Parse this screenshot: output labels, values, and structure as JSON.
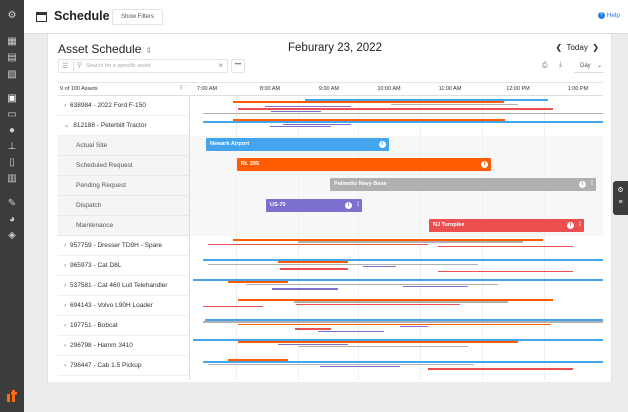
{
  "sidebar": {
    "icons": [
      "settings-icon",
      "grid-icon",
      "chat-icon",
      "document-icon",
      "schedule-icon",
      "monitor-icon",
      "location-icon",
      "org-icon",
      "map-icon",
      "report-icon",
      "wrench-icon",
      "pie-icon",
      "shield-icon"
    ]
  },
  "topbar": {
    "title": "Schedule",
    "show_filters": "Show Filters",
    "help": "Help"
  },
  "card": {
    "title": "Asset Schedule",
    "date": "Feburary 23, 2022",
    "today": "Today",
    "search_placeholder": "Search for a specific asset",
    "view_select": "Day"
  },
  "grid_header": {
    "asset_count": "9 of 100 Assets",
    "times": [
      "7:00 AM",
      "8:00 AM",
      "9:00 AM",
      "10:00 AM",
      "11:00 AM",
      "12:00 PM",
      "1:00 PM"
    ]
  },
  "assets": [
    {
      "label": "638984 - 2022 Ford F-150",
      "expanded": false
    },
    {
      "label": "812188 - Peterbilt Tractor",
      "expanded": true,
      "sub_rows": [
        {
          "label": "Actual Site",
          "event": "Newark Airport",
          "color": "#44a4ee"
        },
        {
          "label": "Scheduled Request",
          "event": "Rt. 295",
          "color": "#ff5b00"
        },
        {
          "label": "Pending Request",
          "event": "Palmetto Navy Base",
          "color": "#b0b0b0"
        },
        {
          "label": "Dispatch",
          "event": "US-70",
          "color": "#7b6fd0"
        },
        {
          "label": "Maintenance",
          "event": "NJ Turnpike",
          "color": "#ec4f4f"
        }
      ]
    },
    {
      "label": "957759 - Dresser TD9H - Spare",
      "expanded": false
    },
    {
      "label": "965973 - Cat D8L",
      "expanded": false
    },
    {
      "label": "537581 - Cat 460 Lull Telehandler",
      "expanded": false
    },
    {
      "label": "694143 - Volvo L90H Loader",
      "expanded": false
    },
    {
      "label": "197751 - Bobcat",
      "expanded": false
    },
    {
      "label": "296798 - Hamm 3410",
      "expanded": false
    },
    {
      "label": "798447 - Cab 1.5 Pickup",
      "expanded": false
    }
  ],
  "colors": {
    "actual": "#44a4ee",
    "scheduled": "#ff5b00",
    "pending": "#b0b0b0",
    "dispatch": "#7b6fd0",
    "maintenance": "#ec4f4f",
    "sidebar": "#3c3c3c",
    "accent": "#2a7fdc"
  }
}
